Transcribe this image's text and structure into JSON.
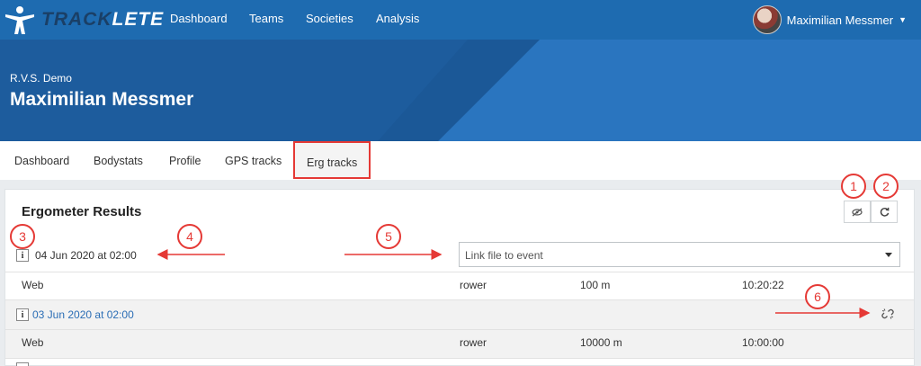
{
  "brand": {
    "part1": "TRACK",
    "part2": "LETE"
  },
  "nav": {
    "items": [
      "Dashboard",
      "Teams",
      "Societies",
      "Analysis"
    ]
  },
  "user": {
    "name": "Maximilian Messmer"
  },
  "header": {
    "club": "R.V.S. Demo",
    "athlete": "Maximilian Messmer"
  },
  "tabs": [
    "Dashboard",
    "Bodystats",
    "Profile",
    "GPS tracks",
    "Erg tracks"
  ],
  "active_tab": "Erg tracks",
  "panel": {
    "title": "Ergometer Results"
  },
  "results": [
    {
      "date": "04 Jun 2020 at 02:00",
      "link_placeholder": "Link file to event",
      "source": "Web",
      "type": "rower",
      "distance": "100 m",
      "time": "10:20:22"
    },
    {
      "date": "03 Jun 2020 at 02:00",
      "source": "Web",
      "type": "rower",
      "distance": "10000 m",
      "time": "10:00:00"
    }
  ],
  "annotations": [
    "1",
    "2",
    "3",
    "4",
    "5",
    "6"
  ],
  "colors": {
    "nav": "#1e6bb0",
    "banner": "#2a75bf",
    "annotation": "#e53935",
    "link": "#2a6db5"
  },
  "icons": {
    "hide": "eye-slash-icon",
    "refresh": "refresh-icon",
    "info": "info-icon",
    "unlink": "unlink-icon",
    "dropdown": "caret-down-icon"
  }
}
